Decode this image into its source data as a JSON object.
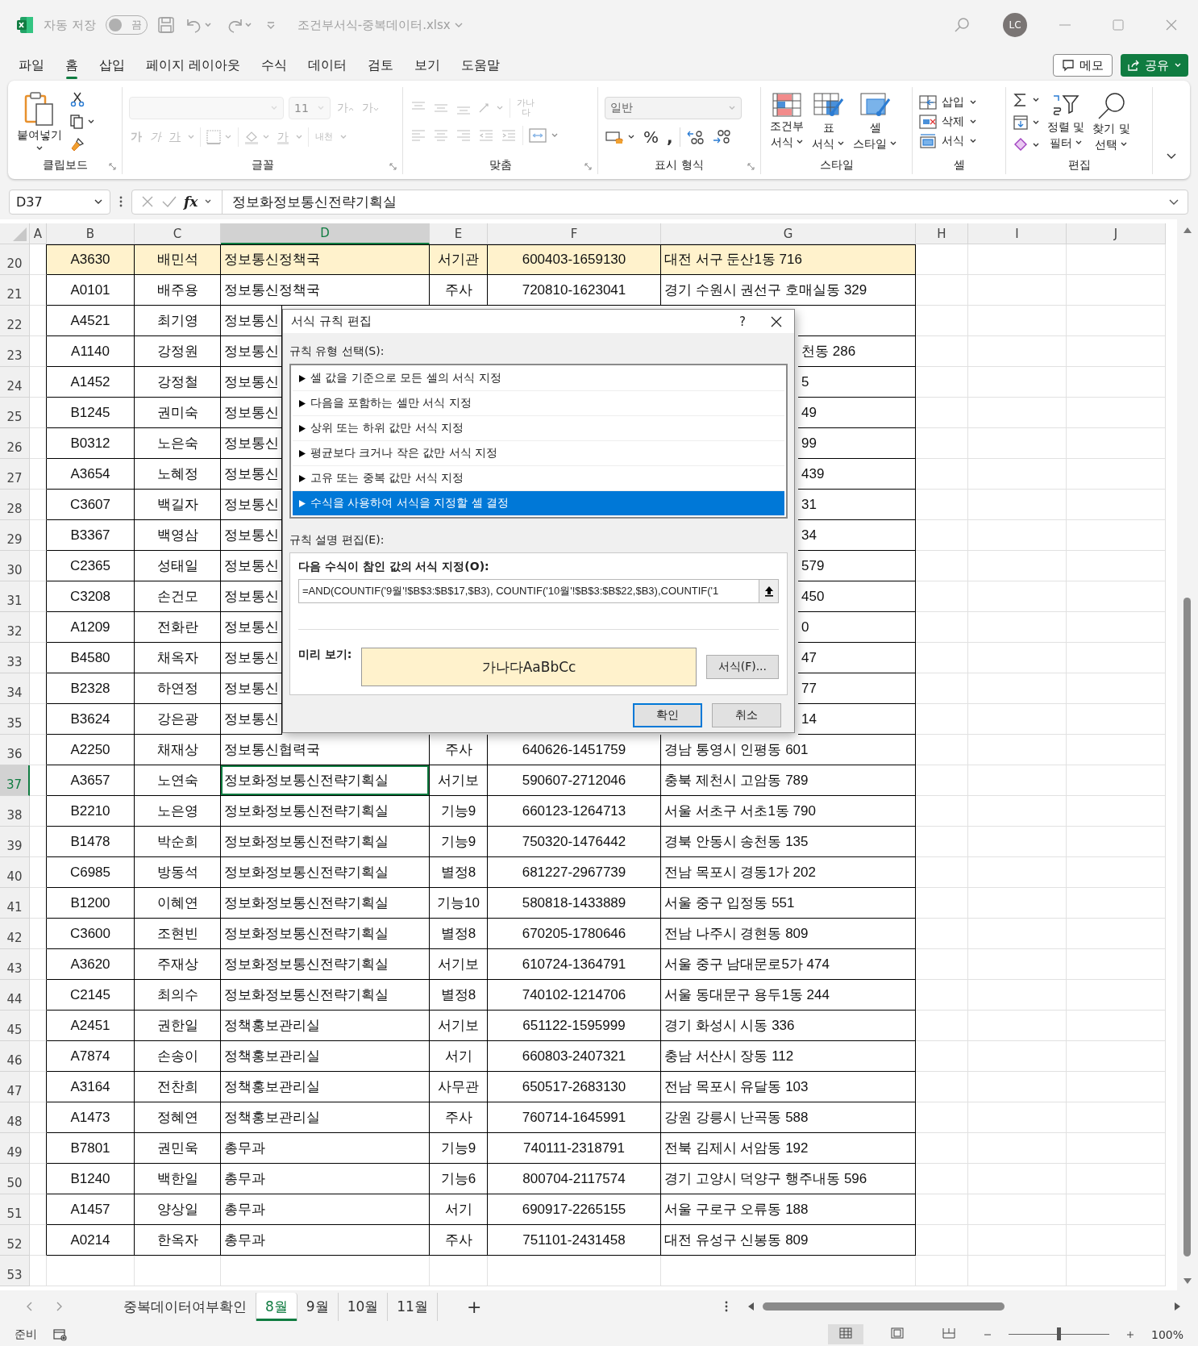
{
  "title_bar": {
    "autosave_label": "자동 저장",
    "autosave": {
      "on": false,
      "label": "끔"
    },
    "file_name": "조건부서식-중복데이터.xlsx",
    "avatar": "LC"
  },
  "menu": {
    "tabs": [
      {
        "label": "파일",
        "selected": false
      },
      {
        "label": "홈",
        "selected": true
      },
      {
        "label": "삽입",
        "selected": false
      },
      {
        "label": "페이지 레이아웃",
        "selected": false
      },
      {
        "label": "수식",
        "selected": false
      },
      {
        "label": "데이터",
        "selected": false
      },
      {
        "label": "검토",
        "selected": false
      },
      {
        "label": "보기",
        "selected": false
      },
      {
        "label": "도움말",
        "selected": false
      }
    ],
    "buttons": [
      {
        "kind": "comment",
        "label": "메모"
      },
      {
        "kind": "share",
        "label": "공유"
      }
    ]
  },
  "ribbon": {
    "groups": [
      {
        "kind": "clipboard",
        "label": "클립보드",
        "disabled": false,
        "paste": "붙여넣기"
      },
      {
        "kind": "font",
        "label": "글꼴",
        "disabled": true,
        "size": "11",
        "grow": "가",
        "shrink": "가",
        "bold": "가",
        "italic": "가",
        "underline": "가",
        "font_color": "가",
        "phonetic": "내천"
      },
      {
        "kind": "alignment",
        "label": "맞춤",
        "disabled": true,
        "wrap": "가나다"
      },
      {
        "kind": "number",
        "label": "표시 형식",
        "disabled": false,
        "format": "일반",
        "percent": "%",
        "comma": ","
      },
      {
        "kind": "styles",
        "label": "스타일",
        "disabled": false,
        "items": [
          {
            "lines": [
              "조건부",
              "서식"
            ]
          },
          {
            "lines": [
              "표",
              "서식"
            ]
          },
          {
            "lines": [
              "셀",
              "스타일"
            ]
          }
        ]
      },
      {
        "kind": "cells",
        "label": "셀",
        "disabled": false,
        "items": [
          "삽입",
          "삭제",
          "서식"
        ]
      },
      {
        "kind": "editing",
        "label": "편집",
        "disabled": false,
        "items": [
          {
            "lines": [
              "정렬 및",
              "필터"
            ]
          },
          {
            "lines": [
              "찾기 및",
              "선택"
            ]
          }
        ]
      }
    ]
  },
  "formula_bar": {
    "name_box": "D37",
    "fx": "fx",
    "formula": "정보화정보통신전략기획실"
  },
  "grid": {
    "columns": [
      {
        "label": "A",
        "selected": false
      },
      {
        "label": "B",
        "selected": false
      },
      {
        "label": "C",
        "selected": false
      },
      {
        "label": "D",
        "selected": true
      },
      {
        "label": "E",
        "selected": false
      },
      {
        "label": "F",
        "selected": false
      },
      {
        "label": "G",
        "selected": false
      },
      {
        "label": "H",
        "selected": false
      },
      {
        "label": "I",
        "selected": false
      },
      {
        "label": "J",
        "selected": false
      }
    ],
    "rows": [
      {
        "row": "20",
        "highlight": true,
        "selected": false,
        "cells": {
          "B": "A3630",
          "C": "배민석",
          "D": "정보통신정책국",
          "E": "서기관",
          "F": "600403-1659130",
          "G": "대전 서구 둔산1동 716"
        }
      },
      {
        "row": "21",
        "highlight": false,
        "selected": false,
        "cells": {
          "B": "A0101",
          "C": "배주용",
          "D": "정보통신정책국",
          "E": "주사",
          "F": "720810-1623041",
          "G": "경기 수원시 권선구 호매실동 329"
        }
      },
      {
        "row": "22",
        "highlight": false,
        "selected": false,
        "cells": {
          "B": "A4521",
          "C": "최기영",
          "D": "정보통신"
        }
      },
      {
        "row": "23",
        "highlight": false,
        "selected": false,
        "cells": {
          "B": "A1140",
          "C": "강정원",
          "D": "정보통신",
          "G": "천동 286"
        }
      },
      {
        "row": "24",
        "highlight": false,
        "selected": false,
        "cells": {
          "B": "A1452",
          "C": "강정철",
          "D": "정보통신",
          "G": "5"
        }
      },
      {
        "row": "25",
        "highlight": false,
        "selected": false,
        "cells": {
          "B": "B1245",
          "C": "권미숙",
          "D": "정보통신",
          "G": "49"
        }
      },
      {
        "row": "26",
        "highlight": false,
        "selected": false,
        "cells": {
          "B": "B0312",
          "C": "노은숙",
          "D": "정보통신",
          "G": "99"
        }
      },
      {
        "row": "27",
        "highlight": false,
        "selected": false,
        "cells": {
          "B": "A3654",
          "C": "노혜정",
          "D": "정보통신",
          "G": "439"
        }
      },
      {
        "row": "28",
        "highlight": false,
        "selected": false,
        "cells": {
          "B": "C3607",
          "C": "백길자",
          "D": "정보통신",
          "G": "31"
        }
      },
      {
        "row": "29",
        "highlight": false,
        "selected": false,
        "cells": {
          "B": "B3367",
          "C": "백영삼",
          "D": "정보통신",
          "G": "34"
        }
      },
      {
        "row": "30",
        "highlight": false,
        "selected": false,
        "cells": {
          "B": "C2365",
          "C": "성태일",
          "D": "정보통신",
          "G": "579"
        }
      },
      {
        "row": "31",
        "highlight": false,
        "selected": false,
        "cells": {
          "B": "C3208",
          "C": "손건모",
          "D": "정보통신",
          "G": "450"
        }
      },
      {
        "row": "32",
        "highlight": false,
        "selected": false,
        "cells": {
          "B": "A1209",
          "C": "전화란",
          "D": "정보통신",
          "G": "0"
        }
      },
      {
        "row": "33",
        "highlight": false,
        "selected": false,
        "cells": {
          "B": "B4580",
          "C": "채옥자",
          "D": "정보통신",
          "G": "47"
        }
      },
      {
        "row": "34",
        "highlight": false,
        "selected": false,
        "cells": {
          "B": "B2328",
          "C": "하연정",
          "D": "정보통신",
          "G": "77"
        }
      },
      {
        "row": "35",
        "highlight": false,
        "selected": false,
        "cells": {
          "B": "B3624",
          "C": "강은광",
          "D": "정보통신",
          "G": "14"
        }
      },
      {
        "row": "36",
        "highlight": false,
        "selected": false,
        "cells": {
          "B": "A2250",
          "C": "채재상",
          "D": "정보통신협력국",
          "E": "주사",
          "F": "640626-1451759",
          "G": "경남 통영시 인평동 601"
        }
      },
      {
        "row": "37",
        "highlight": false,
        "selected": true,
        "cells": {
          "B": "A3657",
          "C": "노연숙",
          "D": "정보화정보통신전략기획실",
          "E": "서기보",
          "F": "590607-2712046",
          "G": "충북 제천시 고암동 789"
        }
      },
      {
        "row": "38",
        "highlight": false,
        "selected": false,
        "cells": {
          "B": "B2210",
          "C": "노은영",
          "D": "정보화정보통신전략기획실",
          "E": "기능9",
          "F": "660123-1264713",
          "G": "서울 서초구 서초1동 790"
        }
      },
      {
        "row": "39",
        "highlight": false,
        "selected": false,
        "cells": {
          "B": "B1478",
          "C": "박순희",
          "D": "정보화정보통신전략기획실",
          "E": "기능9",
          "F": "750320-1476442",
          "G": "경북 안동시 송천동 135"
        }
      },
      {
        "row": "40",
        "highlight": false,
        "selected": false,
        "cells": {
          "B": "C6985",
          "C": "방동석",
          "D": "정보화정보통신전략기획실",
          "E": "별정8",
          "F": "681227-2967739",
          "G": "전남 목포시 경동1가 202"
        }
      },
      {
        "row": "41",
        "highlight": false,
        "selected": false,
        "cells": {
          "B": "B1200",
          "C": "이혜연",
          "D": "정보화정보통신전략기획실",
          "E": "기능10",
          "F": "580818-1433889",
          "G": "서울 중구 입정동 551"
        }
      },
      {
        "row": "42",
        "highlight": false,
        "selected": false,
        "cells": {
          "B": "C3600",
          "C": "조현빈",
          "D": "정보화정보통신전략기획실",
          "E": "별정8",
          "F": "670205-1780646",
          "G": "전남 나주시 경현동 809"
        }
      },
      {
        "row": "43",
        "highlight": false,
        "selected": false,
        "cells": {
          "B": "A3620",
          "C": "주재상",
          "D": "정보화정보통신전략기획실",
          "E": "서기보",
          "F": "610724-1364791",
          "G": "서울 중구 남대문로5가 474"
        }
      },
      {
        "row": "44",
        "highlight": false,
        "selected": false,
        "cells": {
          "B": "C2145",
          "C": "최의수",
          "D": "정보화정보통신전략기획실",
          "E": "별정8",
          "F": "740102-1214706",
          "G": "서울 동대문구 용두1동 244"
        }
      },
      {
        "row": "45",
        "highlight": false,
        "selected": false,
        "cells": {
          "B": "A2451",
          "C": "권한일",
          "D": "정책홍보관리실",
          "E": "서기보",
          "F": "651122-1595999",
          "G": "경기 화성시 시동 336"
        }
      },
      {
        "row": "46",
        "highlight": false,
        "selected": false,
        "cells": {
          "B": "A7874",
          "C": "손송이",
          "D": "정책홍보관리실",
          "E": "서기",
          "F": "660803-2407321",
          "G": "충남 서산시 장동 112"
        }
      },
      {
        "row": "47",
        "highlight": false,
        "selected": false,
        "cells": {
          "B": "A3164",
          "C": "전찬희",
          "D": "정책홍보관리실",
          "E": "사무관",
          "F": "650517-2683130",
          "G": "전남 목포시 유달동 103"
        }
      },
      {
        "row": "48",
        "highlight": false,
        "selected": false,
        "cells": {
          "B": "A1473",
          "C": "정혜연",
          "D": "정책홍보관리실",
          "E": "주사",
          "F": "760714-1645991",
          "G": "강원 강릉시 난곡동 588"
        }
      },
      {
        "row": "49",
        "highlight": false,
        "selected": false,
        "cells": {
          "B": "B7801",
          "C": "권민욱",
          "D": "총무과",
          "E": "기능9",
          "F": "740111-2318791",
          "G": "전북 김제시 서암동 192"
        }
      },
      {
        "row": "50",
        "highlight": false,
        "selected": false,
        "cells": {
          "B": "B1240",
          "C": "백한일",
          "D": "총무과",
          "E": "기능6",
          "F": "800704-2117574",
          "G": "경기 고양시 덕양구 행주내동 596"
        }
      },
      {
        "row": "51",
        "highlight": false,
        "selected": false,
        "cells": {
          "B": "A1457",
          "C": "양상일",
          "D": "총무과",
          "E": "서기",
          "F": "690917-2265155",
          "G": "서울 구로구 오류동 188"
        }
      },
      {
        "row": "52",
        "highlight": false,
        "selected": false,
        "cells": {
          "B": "A0214",
          "C": "한옥자",
          "D": "총무과",
          "E": "주사",
          "F": "751101-2431458",
          "G": "대전 유성구 신봉동 809"
        }
      },
      {
        "row": "53",
        "highlight": false,
        "selected": false,
        "cells": {}
      }
    ]
  },
  "dialog": {
    "title": "서식 규칙 편집",
    "help": "?",
    "type_label": "규칙 유형 선택(S):",
    "rule_types": [
      {
        "label": "셀 값을 기준으로 모든 셀의 서식 지정",
        "selected": false
      },
      {
        "label": "다음을 포함하는 셀만 서식 지정",
        "selected": false
      },
      {
        "label": "상위 또는 하위 값만 서식 지정",
        "selected": false
      },
      {
        "label": "평균보다 크거나 작은 값만 서식 지정",
        "selected": false
      },
      {
        "label": "고유 또는 중복 값만 서식 지정",
        "selected": false
      },
      {
        "label": "수식을 사용하여 서식을 지정할 셀 결정",
        "selected": true
      }
    ],
    "description_label": "규칙 설명 편집(E):",
    "formula_label": "다음 수식이 참인 값의 서식 지정(O):",
    "formula": "=AND(COUNTIF('9월'!$B$3:$B$17,$B3), COUNTIF('10월'!$B$3:$B$22,$B3),COUNTIF('1",
    "preview_label": "미리 보기:",
    "preview": "가나다AaBbCc",
    "format_button": "서식(F)...",
    "ok": "확인",
    "cancel": "취소"
  },
  "sheet_tabs": {
    "tabs": [
      {
        "label": "중복데이터여부확인",
        "selected": false
      },
      {
        "label": "8월",
        "selected": true
      },
      {
        "label": "9월",
        "selected": false
      },
      {
        "label": "10월",
        "selected": false
      },
      {
        "label": "11월",
        "selected": false
      }
    ],
    "add": "+"
  },
  "status_bar": {
    "status": "준비",
    "zoom_slider": {
      "level": 0.5
    },
    "zoom": "100%"
  }
}
